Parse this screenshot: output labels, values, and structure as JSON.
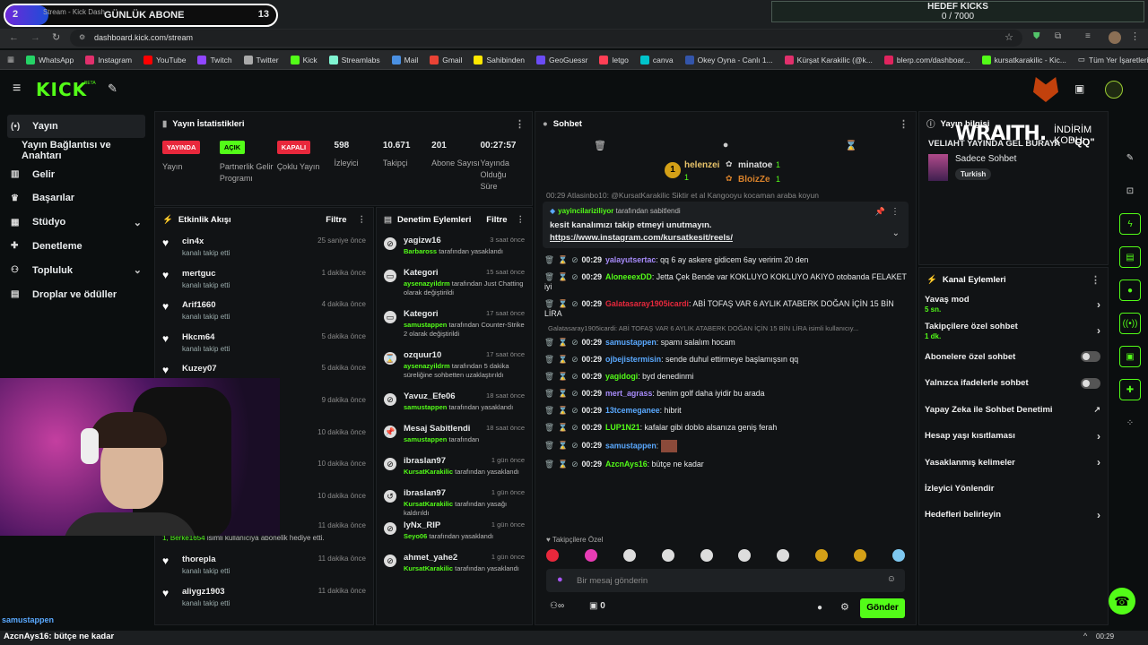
{
  "overlay": {
    "sub_goal_number": "2",
    "sub_goal_label": "GÜNLÜK ABONE",
    "sub_goal_count": "13",
    "kick_goal_title": "HEDEF KICKS",
    "kick_goal_value": "0 / 7000",
    "wraith_brand": "WRAITH.",
    "wraith_code": "İNDİRİM KODU:",
    "wraith_code_value": "\"QQ\"",
    "bottom_chat_user": "samustappen",
    "bottom_chat_msg_user": "AzcnAys16",
    "bottom_chat_msg": "bütçe ne kadar"
  },
  "browser": {
    "tab_title": "Stream - Kick Dash",
    "url": "dashboard.kick.com/stream",
    "time": "00:29",
    "bookmarks": [
      {
        "label": "WhatsApp",
        "color": "#25d366"
      },
      {
        "label": "Instagram",
        "color": "#e1306c"
      },
      {
        "label": "YouTube",
        "color": "#ff0000"
      },
      {
        "label": "Twitch",
        "color": "#9146ff"
      },
      {
        "label": "Twitter",
        "color": "#aaaaaa"
      },
      {
        "label": "Kick",
        "color": "#53fc18"
      },
      {
        "label": "Streamlabs",
        "color": "#80f5d2"
      },
      {
        "label": "Mail",
        "color": "#4a90e2"
      },
      {
        "label": "Gmail",
        "color": "#ea4335"
      },
      {
        "label": "Sahibinden",
        "color": "#ffe800"
      },
      {
        "label": "GeoGuessr",
        "color": "#6b4cf6"
      },
      {
        "label": "letgo",
        "color": "#ff3f55"
      },
      {
        "label": "canva",
        "color": "#00c4cc"
      },
      {
        "label": "Okey Oyna - Canlı 1...",
        "color": "#3355aa"
      },
      {
        "label": "Kürşat Karakilic (@k...",
        "color": "#e1306c"
      },
      {
        "label": "blerp.com/dashboar...",
        "color": "#e0245e"
      },
      {
        "label": "kursatkarakilic - Kic...",
        "color": "#53fc18"
      }
    ],
    "all_bookmarks": "Tüm Yer İşaretleri"
  },
  "brand": {
    "logo": "KICK",
    "beta": "BETA"
  },
  "sidebar": {
    "items": [
      {
        "label": "Yayın",
        "icon": "broadcast-icon"
      },
      {
        "label": "Yayın Bağlantısı ve Anahtarı",
        "icon": ""
      },
      {
        "label": "Gelir",
        "icon": "bank-icon"
      },
      {
        "label": "Başarılar",
        "icon": "trophy-icon"
      },
      {
        "label": "Stüdyo",
        "icon": "grid-icon"
      },
      {
        "label": "Denetleme",
        "icon": "wrench-icon"
      },
      {
        "label": "Topluluk",
        "icon": "people-icon"
      },
      {
        "label": "Droplar ve ödüller",
        "icon": "gift-icon"
      }
    ]
  },
  "stats": {
    "title": "Yayın İstatistikleri",
    "items": [
      {
        "badge": "YAYINDA",
        "label": "Yayın",
        "color": "#e8283c"
      },
      {
        "badge": "AÇIK",
        "label": "Partnerlik Gelir Programı",
        "color": "#53fc18"
      },
      {
        "badge": "KAPALI",
        "label": "Çoklu Yayın",
        "color": "#e8283c"
      }
    ],
    "numbers": [
      {
        "value": "598",
        "label": "İzleyici"
      },
      {
        "value": "10.671",
        "label": "Takipçi"
      },
      {
        "value": "201",
        "label": "Abone Sayısı"
      },
      {
        "value": "00:27:57",
        "label": "Yayında Olduğu Süre"
      }
    ]
  },
  "activity": {
    "title": "Etkinlik Akışı",
    "filter": "Filtre",
    "rows": [
      {
        "name": "cin4x",
        "sub": "kanalı takip etti",
        "time": "25 saniye önce"
      },
      {
        "name": "mertguc",
        "sub": "kanalı takip etti",
        "time": "1 dakika önce"
      },
      {
        "name": "Arif1660",
        "sub": "kanalı takip etti",
        "time": "4 dakika önce"
      },
      {
        "name": "Hkcm64",
        "sub": "kanalı takip etti",
        "time": "5 dakika önce"
      },
      {
        "name": "Kuzey07",
        "sub": "",
        "time": "5 dakika önce"
      },
      {
        "name": "",
        "sub": "",
        "time": "9 dakika önce"
      },
      {
        "name": "",
        "sub": "",
        "time": "10 dakika önce"
      },
      {
        "name": "",
        "sub": "",
        "time": "10 dakika önce"
      },
      {
        "name": "",
        "sub": "",
        "time": "10 dakika önce"
      }
    ],
    "gift_time": "11 dakika önce",
    "gift_user": "1, Berke1654",
    "gift_text": "isimli kullanıcıya abonelik hediye etti.",
    "tail": [
      {
        "name": "thorepla",
        "sub": "kanalı takip etti",
        "time": "11 dakika önce"
      },
      {
        "name": "aliygz1903",
        "sub": "kanalı takip etti",
        "time": "11 dakika önce"
      }
    ]
  },
  "modlog": {
    "title": "Denetim Eylemleri",
    "filter": "Filtre",
    "rows": [
      {
        "name": "yagizw16",
        "actor": "Barbaross",
        "text": "tarafından yasaklandı",
        "time": "3 saat önce",
        "icon": "ban-icon"
      },
      {
        "name": "Kategori",
        "actor": "aysenazyildrm",
        "text": "tarafından Just Chatting olarak değiştirildi",
        "time": "15 saat önce",
        "icon": "category-icon"
      },
      {
        "name": "Kategori",
        "actor": "samustappen",
        "text": "tarafından Counter-Strike 2 olarak değiştirildi",
        "time": "17 saat önce",
        "icon": "category-icon"
      },
      {
        "name": "ozquur10",
        "actor": "aysenazyildrm",
        "text": "tarafından 5 dakika süreliğine sohbetten uzaklaştırıldı",
        "time": "17 saat önce",
        "icon": "timeout-icon"
      },
      {
        "name": "Yavuz_Efe06",
        "actor": "samustappen",
        "text": "tarafından yasaklandı",
        "time": "18 saat önce",
        "icon": "ban-icon"
      },
      {
        "name": "Mesaj Sabitlendi",
        "actor": "samustappen",
        "text": "tarafından",
        "time": "18 saat önce",
        "icon": "pin-icon"
      },
      {
        "name": "ibraslan97",
        "actor": "KursatKarakilic",
        "text": "tarafından yasaklandı",
        "time": "1 gün önce",
        "icon": "ban-icon"
      },
      {
        "name": "ibraslan97",
        "actor": "KursatKarakilic",
        "text": "tarafından yasağı kaldırıldı",
        "time": "1 gün önce",
        "icon": "unban-icon"
      },
      {
        "name": "lyNx_RIP",
        "actor": "Seyo06",
        "text": "tarafından yasaklandı",
        "time": "1 gün önce",
        "icon": "ban-icon"
      },
      {
        "name": "ahmet_yahe2",
        "actor": "KursatKarakilic",
        "text": "tarafından yasaklandı",
        "time": "1 gün önce",
        "icon": "ban-icon"
      }
    ]
  },
  "chat": {
    "title": "Sohbet",
    "top1": "helenzei",
    "top1_count": "1",
    "top2": "minatoe",
    "top2_count": "1",
    "top3": "BloizZe",
    "top3_count": "1",
    "pinned_by": "yayincilariziliyor",
    "pinned_label": "tarafından sabitlendi",
    "pinned_text": "kesit kanalımızı takip etmeyi unutmayın.",
    "pinned_link": "https://www.instagram.com/kursatkesit/reels/",
    "partial": "00:29 Atlasinbo10: @KursatKarakilic Siktir et al Kangooyu kocaman araba koyun",
    "messages": [
      {
        "time": "00:29",
        "user": "yalayutsertac",
        "color": "#a78bfa",
        "text": "qq 6 ay askere gidicem 6ay veririm 20 den"
      },
      {
        "time": "00:29",
        "user": "AloneeexDD",
        "color": "#53fc18",
        "text": "Jetta Çek Bende var KOKLUYO KOKLUYO AKIYO otobanda FELAKET iyi"
      },
      {
        "time": "00:29",
        "user": "Galatasaray1905icardi",
        "color": "#e8283c",
        "text": "ABİ TOFAŞ VAR 6 AYLIK ATABERK DOĞAN İÇİN 15 BİN LİRA"
      },
      {
        "time": "00:29",
        "user": "samustappen",
        "color": "#5aa9ff",
        "text": "spamı salalım hocam"
      },
      {
        "time": "00:29",
        "user": "ojbejistermisin",
        "color": "#5aa9ff",
        "text": "sende duhul ettirmeye başlamışsın qq"
      },
      {
        "time": "00:29",
        "user": "yagidogi",
        "color": "#53fc18",
        "text": "byd denedinmi"
      },
      {
        "time": "00:29",
        "user": "mert_agrass",
        "color": "#a78bfa",
        "text": "benim golf daha iyidir bu arada"
      },
      {
        "time": "00:29",
        "user": "13tcemeganee",
        "color": "#5aa9ff",
        "text": "hibrit"
      },
      {
        "time": "00:29",
        "user": "LUP1N21",
        "color": "#53fc18",
        "text": "kafalar gibi doblo alsanıza geniş ferah"
      },
      {
        "time": "00:29",
        "user": "samustappen",
        "color": "#5aa9ff",
        "text": ""
      },
      {
        "time": "00:29",
        "user": "AzcnAys16",
        "color": "#53fc18",
        "text": "bütçe ne kadar"
      }
    ],
    "reply_ref": "Galatasaray1905icardi: ABİ TOFAŞ VAR 6 AYLIK ATABERK DOĞAN İÇİN 15 BİN LİRA isimli kullanıcıy...",
    "followers_only": "Takipçilere Özel",
    "input_placeholder": "Bir mesaj gönderin",
    "send": "Gönder",
    "points": "0"
  },
  "info": {
    "title": "Yayın bilgisi",
    "stream_title": "VELIAHT YAYINDA GEL BURAYA",
    "category": "Sadece Sohbet",
    "tag": "Turkish"
  },
  "actions": {
    "title": "Kanal Eylemleri",
    "items": [
      {
        "label": "Yavaş mod",
        "sub": "5 sn.",
        "kind": "chev"
      },
      {
        "label": "Takipçilere özel sohbet",
        "sub": "1 dk.",
        "kind": "chev"
      },
      {
        "label": "Abonelere özel sohbet",
        "sub": "",
        "kind": "toggle"
      },
      {
        "label": "Yalnızca ifadelerle sohbet",
        "sub": "",
        "kind": "toggle"
      },
      {
        "label": "Yapay Zeka ile Sohbet Denetimi",
        "sub": "",
        "kind": "ext"
      },
      {
        "label": "Hesap yaşı kısıtlaması",
        "sub": "",
        "kind": "chev"
      },
      {
        "label": "Yasaklanmış kelimeler",
        "sub": "",
        "kind": "chev"
      },
      {
        "label": "İzleyici Yönlendir",
        "sub": "",
        "kind": "none"
      },
      {
        "label": "Hedefleri belirleyin",
        "sub": "",
        "kind": "chev"
      }
    ]
  }
}
